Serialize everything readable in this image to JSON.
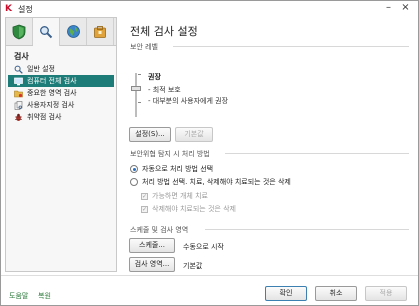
{
  "window": {
    "title": "설정",
    "app_icon": "K",
    "minimize": "–",
    "close": "×"
  },
  "left": {
    "section_title": "검사",
    "tabs": [
      {
        "icon": "shield-icon"
      },
      {
        "icon": "magnifier-icon"
      },
      {
        "icon": "globe-icon"
      },
      {
        "icon": "box-icon"
      }
    ],
    "items": [
      {
        "label": "일반 설정"
      },
      {
        "label": "컴퓨터 전체 검사"
      },
      {
        "label": "중요한 영역 검사"
      },
      {
        "label": "사용자지정 검사"
      },
      {
        "label": "취약점 검사"
      }
    ]
  },
  "main": {
    "title": "전체 검사 설정",
    "security_level": {
      "group_label": "보안 레벨",
      "level_name": "권장",
      "lines": [
        "- 최적 보호",
        "- 대부분의 사용자에게 권장"
      ],
      "settings_button": "설정(S)...",
      "default_button": "기본값"
    },
    "action": {
      "group_label": "보안위협 탐지 시 처리 방법",
      "option1": "자동으로 처리 방법 선택",
      "option2": "처리 방법 선택. 치료, 삭제해야 치료되는 것은 삭제",
      "check1": "가능하면 개체 치료",
      "check2": "삭제해야 치료되는 것은 삭제"
    },
    "schedule": {
      "group_label": "스케줄 및 검사 영역",
      "schedule_button": "스케줄...",
      "schedule_value": "수동으로 시작",
      "scope_button": "검사 영역...",
      "scope_value": "기본값"
    }
  },
  "footer": {
    "help": "도움말",
    "restore": "복원",
    "ok": "확인",
    "cancel": "취소",
    "apply": "적용"
  },
  "colors": {
    "accent": "#1e7c78",
    "link": "#2a7a3a",
    "brand": "#c8102e"
  }
}
